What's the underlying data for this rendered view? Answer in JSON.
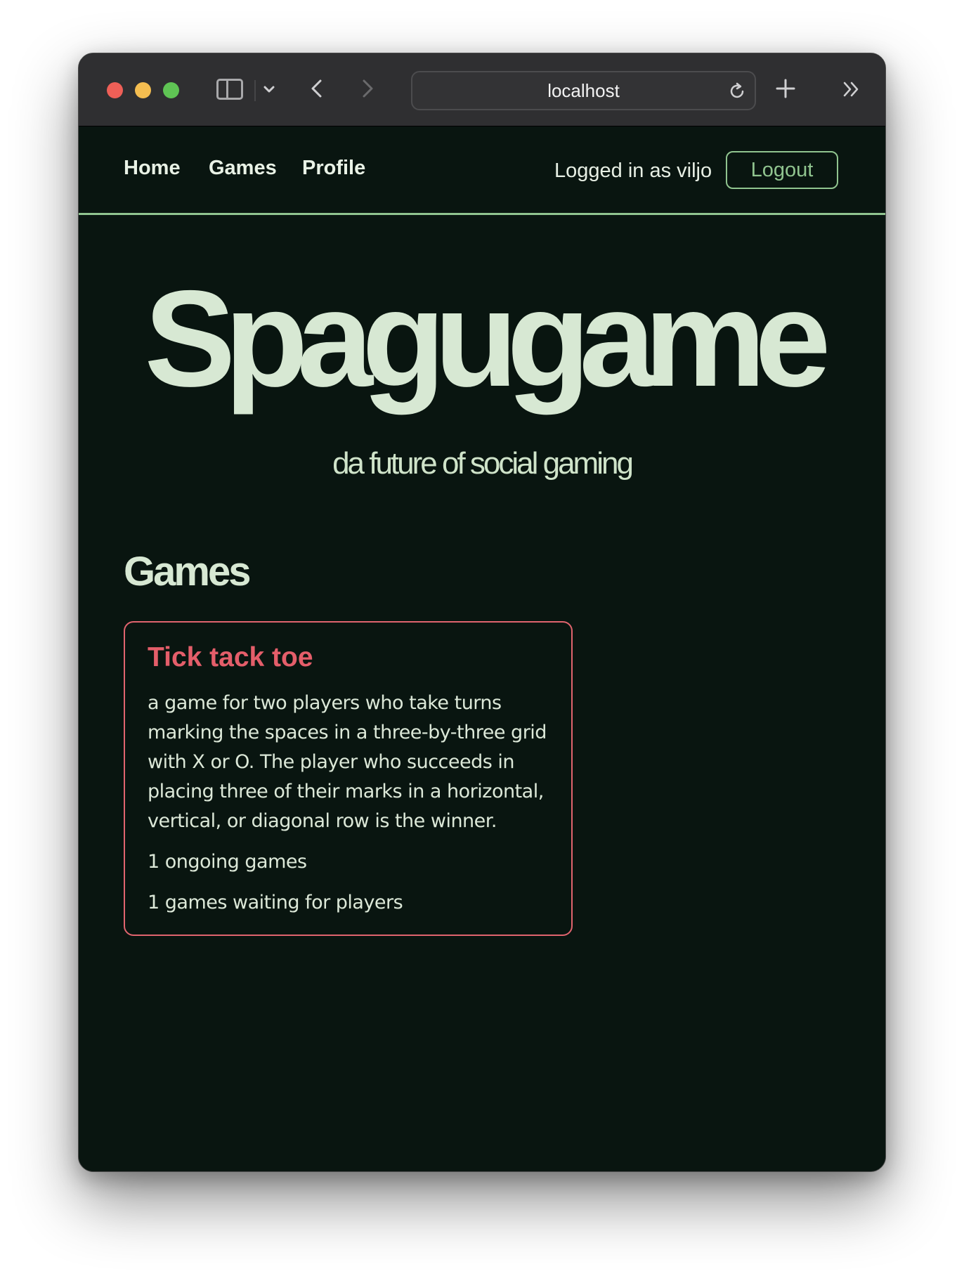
{
  "browser": {
    "url": "localhost",
    "icons": [
      "sidebar-icon",
      "chevron-down-icon",
      "back-arrow-icon",
      "forward-arrow-icon",
      "reload-icon",
      "plus-icon",
      "double-chevron-icon"
    ]
  },
  "nav": {
    "links": [
      {
        "label": "Home"
      },
      {
        "label": "Games"
      },
      {
        "label": "Profile"
      }
    ],
    "login_status": "Logged in as viljo",
    "logout_label": "Logout"
  },
  "hero": {
    "title": "Spagugame",
    "subtitle": "da future of social gaming"
  },
  "games_section": {
    "title": "Games",
    "cards": [
      {
        "title": "Tick tack toe",
        "description": "a game for two players who take turns marking the spaces in a three-by-three grid with X or O. The player who succeeds in placing three of their marks in a horizontal, vertical, or diagonal row is the winner.",
        "ongoing": "1 ongoing games",
        "waiting": "1 games waiting for players"
      }
    ]
  },
  "colors": {
    "background": "#091510",
    "accent_green": "#90c48f",
    "heading": "#d7e8d3",
    "card_accent": "#e45e6a"
  }
}
